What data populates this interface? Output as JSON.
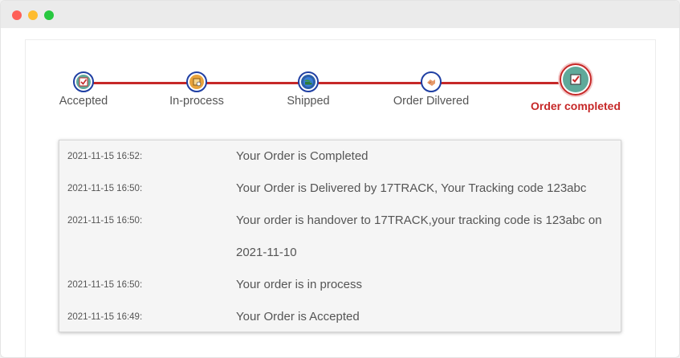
{
  "window": {
    "controls": [
      "close",
      "minimize",
      "maximize"
    ]
  },
  "steps": [
    {
      "label": "Accepted",
      "icon": "checkbox-icon",
      "color": "#5fa99a"
    },
    {
      "label": "In-process",
      "icon": "package-icon",
      "color": "#e8a33c"
    },
    {
      "label": "Shipped",
      "icon": "globe-truck-icon",
      "color": "#2d7d3a"
    },
    {
      "label": "Order Dilvered",
      "icon": "handshake-icon",
      "color": "#e69a6a"
    },
    {
      "label": "Order completed",
      "icon": "checkbox-icon",
      "color": "#c62828",
      "active": true
    }
  ],
  "log": [
    {
      "time": "2021-11-15 16:52:",
      "message": "Your Order is Completed"
    },
    {
      "time": "2021-11-15 16:50:",
      "message": "Your Order is Delivered by 17TRACK, Your Tracking code 123abc"
    },
    {
      "time": "2021-11-15 16:50:",
      "message": "Your order is handover to 17TRACK,your tracking code is 123abc on",
      "message_cont": "2021-11-10"
    },
    {
      "time": "2021-11-15 16:50:",
      "message": "Your order is in process"
    },
    {
      "time": "2021-11-15 16:49:",
      "message": "Your Order is Accepted"
    }
  ],
  "colors": {
    "accent": "#c62828",
    "stepBorder": "#1f3fa3"
  }
}
